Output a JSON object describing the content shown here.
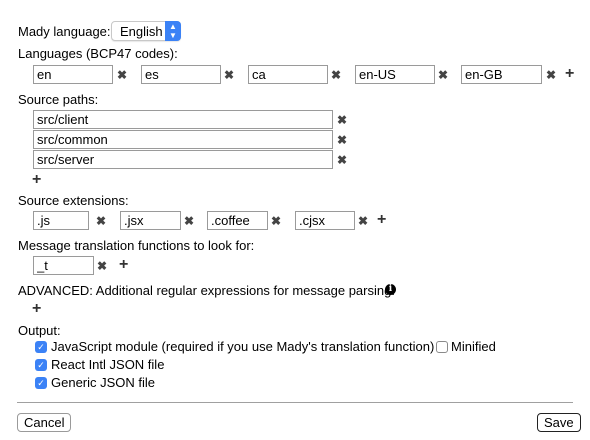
{
  "mady_language": {
    "label": "Mady language:",
    "selected": "English"
  },
  "languages": {
    "label": "Languages (BCP47 codes):",
    "values": [
      "en",
      "es",
      "ca",
      "en-US",
      "en-GB"
    ]
  },
  "source_paths": {
    "label": "Source paths:",
    "values": [
      "src/client",
      "src/common",
      "src/server"
    ]
  },
  "source_extensions": {
    "label": "Source extensions:",
    "values": [
      ".js",
      ".jsx",
      ".coffee",
      ".cjsx"
    ]
  },
  "message_functions": {
    "label": "Message translation functions to look for:",
    "values": [
      "_t"
    ]
  },
  "advanced": {
    "label": "ADVANCED: Additional regular expressions for message parsing:",
    "info_icon": "i"
  },
  "output": {
    "label": "Output:",
    "js_module": {
      "label": "JavaScript module (required if you use Mady's translation function)",
      "checked": true
    },
    "minified": {
      "label": "Minified",
      "checked": false
    },
    "react_intl": {
      "label": "React Intl JSON file",
      "checked": true
    },
    "generic_json": {
      "label": "Generic JSON file",
      "checked": true
    }
  },
  "icons": {
    "remove": "✖",
    "add": "+",
    "check": "✓"
  },
  "colors": {
    "accent": "#3b82f6"
  },
  "buttons": {
    "cancel": "Cancel",
    "save": "Save"
  }
}
